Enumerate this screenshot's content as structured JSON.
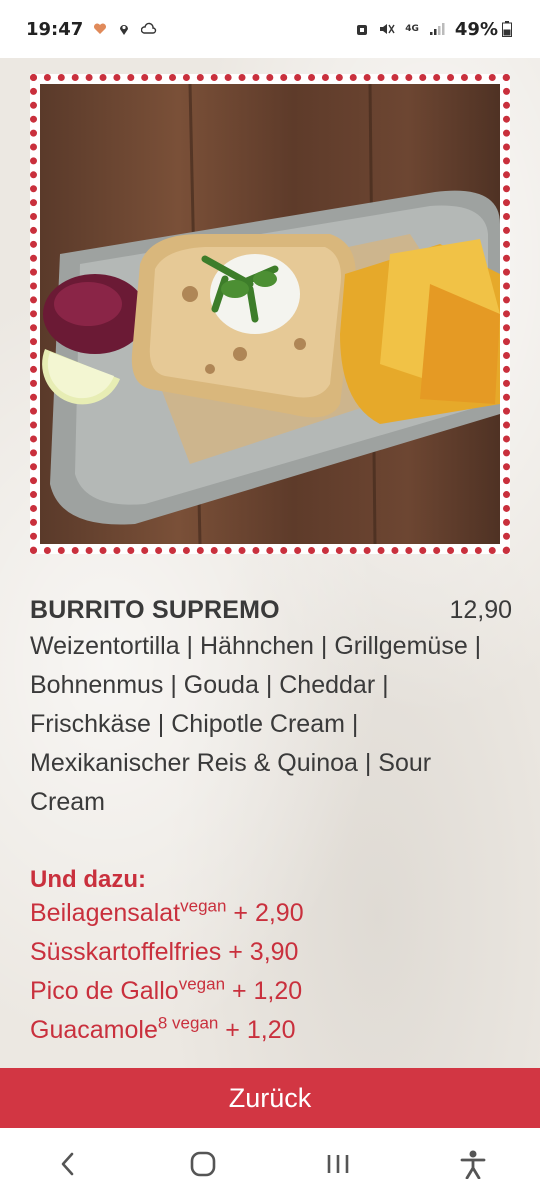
{
  "status": {
    "time": "19:47",
    "battery": "49%",
    "network": "4G"
  },
  "photo": {
    "alt_icon": "burrito-photo"
  },
  "dish": {
    "name": "BURRITO SUPREMO",
    "price": "12,90",
    "description": "Weizentortilla | Hähnchen | Grillgemüse | Bohnenmus | Gouda | Cheddar | Frischkäse | Chipotle Cream | Mexikanischer Reis & Quinoa | Sour Cream"
  },
  "addons": {
    "title": "Und dazu:",
    "items": [
      {
        "name": "Beilagensalat",
        "sup": "vegan",
        "price": " + 2,90"
      },
      {
        "name": "Süsskartoffelfries",
        "sup": "",
        "price": " + 3,90"
      },
      {
        "name": "Pico de Gallo",
        "sup": "vegan",
        "price": " + 1,20"
      },
      {
        "name": "Guacamole",
        "sup": "8 vegan",
        "price": " + 1,20"
      }
    ]
  },
  "back_button": {
    "label": "Zurück"
  },
  "colors": {
    "accent": "#d23643",
    "addon_text": "#c9303d",
    "body_text": "#3a3a3a"
  },
  "icons": [
    "heart-icon",
    "location-icon",
    "cloud-icon",
    "alarm-icon",
    "mute-icon",
    "signal-icon",
    "battery-icon",
    "back-nav-icon",
    "home-nav-icon",
    "recents-nav-icon",
    "accessibility-icon"
  ]
}
